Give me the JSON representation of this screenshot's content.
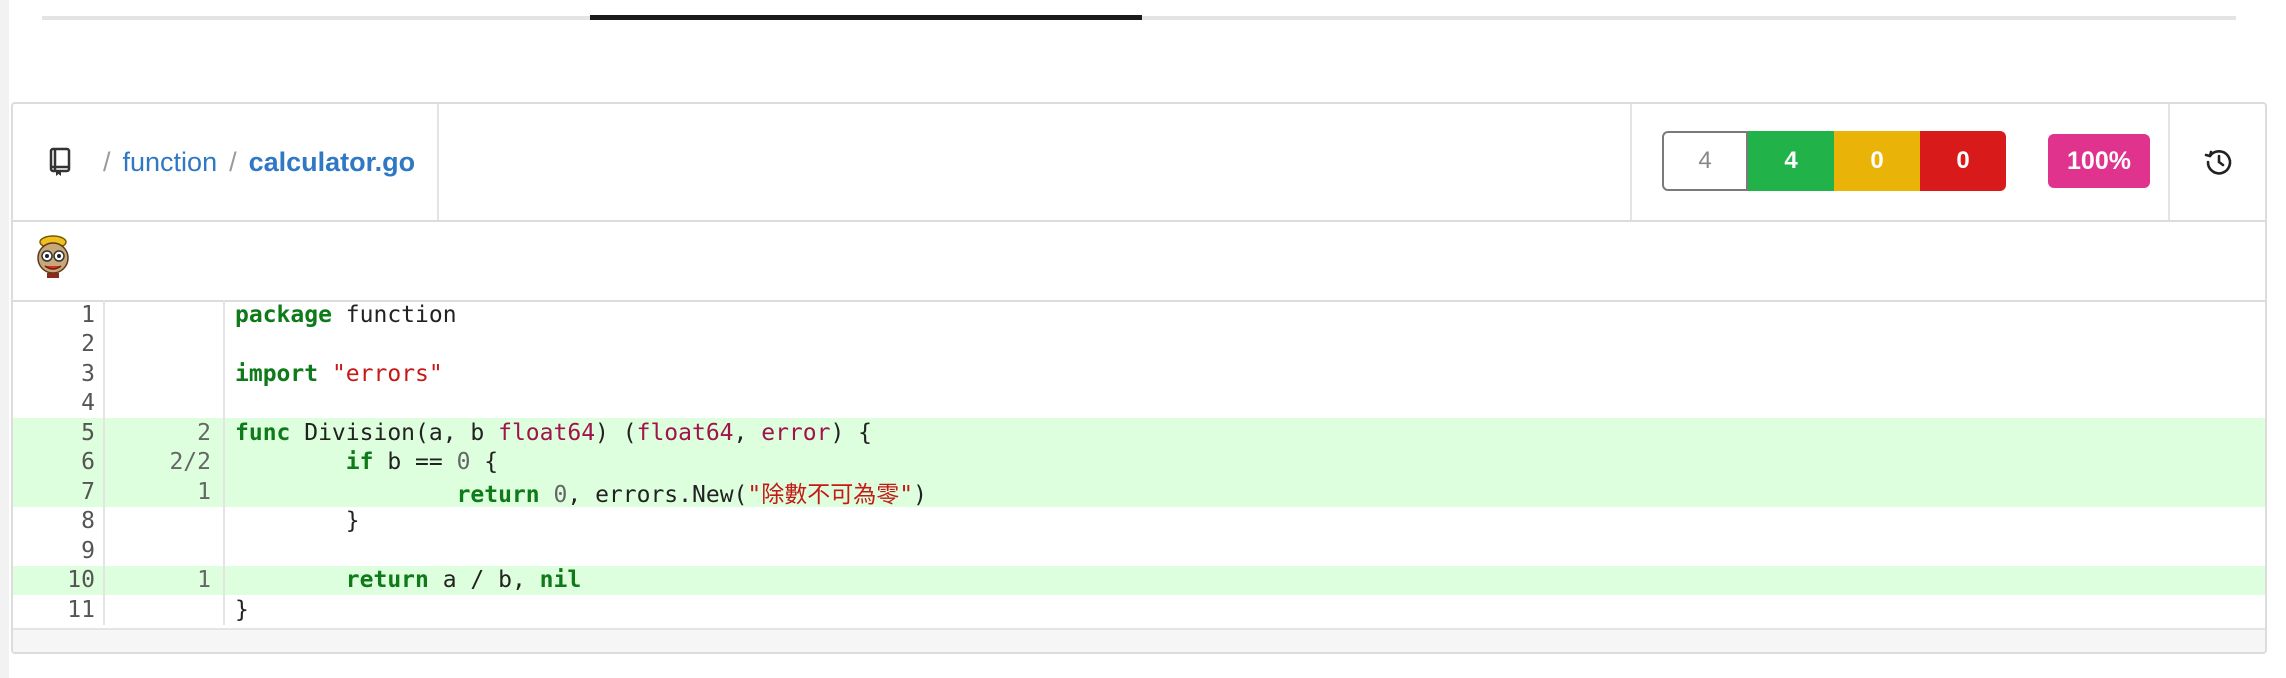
{
  "breadcrumb": {
    "separator": "/",
    "folder": "function",
    "file": "calculator.go"
  },
  "stats": {
    "total": "4",
    "hit": "4",
    "partial": "0",
    "missed": "0",
    "coverage": "100%"
  },
  "colors": {
    "hit": "#21b24a",
    "partial": "#eab308",
    "missed": "#d91a1a",
    "coverage": "#e0338e",
    "covered_line_bg": "#ddffdd",
    "link": "#2f78c4"
  },
  "icons": {
    "repo": "repo-book-icon",
    "history": "history-icon",
    "avatar": "gopher-avatar-icon"
  },
  "code": {
    "lines": [
      {
        "n": "1",
        "hits": "",
        "covered": false,
        "tokens": [
          {
            "t": "package",
            "c": "kw"
          },
          {
            "t": " function",
            "c": ""
          }
        ]
      },
      {
        "n": "2",
        "hits": "",
        "covered": false,
        "tokens": []
      },
      {
        "n": "3",
        "hits": "",
        "covered": false,
        "tokens": [
          {
            "t": "import",
            "c": "kw"
          },
          {
            "t": " ",
            "c": ""
          },
          {
            "t": "\"errors\"",
            "c": "str"
          }
        ]
      },
      {
        "n": "4",
        "hits": "",
        "covered": false,
        "tokens": []
      },
      {
        "n": "5",
        "hits": "2",
        "covered": true,
        "tokens": [
          {
            "t": "func",
            "c": "kw"
          },
          {
            "t": " Division(a, b ",
            "c": ""
          },
          {
            "t": "float64",
            "c": "typ"
          },
          {
            "t": ") (",
            "c": ""
          },
          {
            "t": "float64",
            "c": "typ"
          },
          {
            "t": ", ",
            "c": ""
          },
          {
            "t": "error",
            "c": "typ"
          },
          {
            "t": ") {",
            "c": ""
          }
        ]
      },
      {
        "n": "6",
        "hits": "2/2",
        "covered": true,
        "tokens": [
          {
            "t": "        ",
            "c": ""
          },
          {
            "t": "if",
            "c": "kw"
          },
          {
            "t": " b == ",
            "c": ""
          },
          {
            "t": "0",
            "c": "num"
          },
          {
            "t": " {",
            "c": ""
          }
        ]
      },
      {
        "n": "7",
        "hits": "1",
        "covered": true,
        "tokens": [
          {
            "t": "                ",
            "c": ""
          },
          {
            "t": "return",
            "c": "kw"
          },
          {
            "t": " ",
            "c": ""
          },
          {
            "t": "0",
            "c": "num"
          },
          {
            "t": ", errors.New(",
            "c": ""
          },
          {
            "t": "\"除數不可為零\"",
            "c": "str"
          },
          {
            "t": ")",
            "c": ""
          }
        ]
      },
      {
        "n": "8",
        "hits": "",
        "covered": false,
        "tokens": [
          {
            "t": "        }",
            "c": ""
          }
        ]
      },
      {
        "n": "9",
        "hits": "",
        "covered": false,
        "tokens": []
      },
      {
        "n": "10",
        "hits": "1",
        "covered": true,
        "tokens": [
          {
            "t": "        ",
            "c": ""
          },
          {
            "t": "return",
            "c": "kw"
          },
          {
            "t": " a / b, ",
            "c": ""
          },
          {
            "t": "nil",
            "c": "kw"
          }
        ]
      },
      {
        "n": "11",
        "hits": "",
        "covered": false,
        "tokens": [
          {
            "t": "}",
            "c": ""
          }
        ]
      }
    ]
  }
}
